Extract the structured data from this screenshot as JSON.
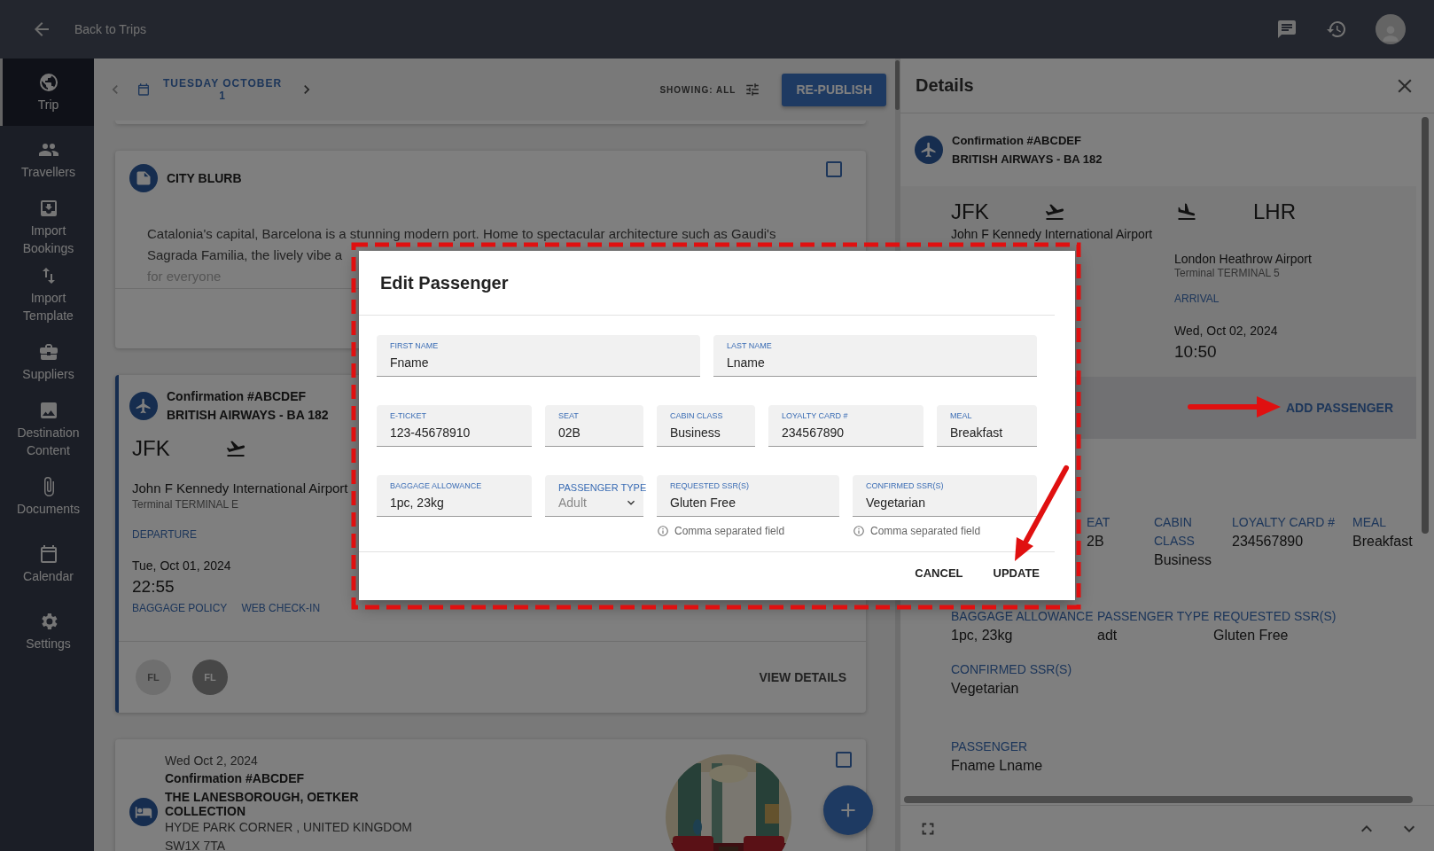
{
  "top_bar": {
    "back_label": "Back to Trips"
  },
  "sidebar": {
    "items": [
      {
        "label": "Trip",
        "selected": true
      },
      {
        "label": "Travellers",
        "selected": false
      },
      {
        "label": "Import Bookings",
        "selected": false
      },
      {
        "label": "Import Template",
        "selected": false
      },
      {
        "label": "Suppliers",
        "selected": false
      },
      {
        "label": "Destination Content",
        "selected": false
      },
      {
        "label": "Documents",
        "selected": false
      },
      {
        "label": "Calendar",
        "selected": false
      },
      {
        "label": "Settings",
        "selected": false
      }
    ]
  },
  "day_nav": {
    "date": "TUESDAY OCTOBER 1",
    "filter_label": "SHOWING: ALL",
    "publish_button": "RE-PUBLISH"
  },
  "cards": [
    {
      "kind": "stub"
    },
    {
      "kind": "blurb",
      "title": "CITY BLURB",
      "checked": false,
      "lines": [
        "Catalonia's capital, Barcelona is a stunning modern port. Home to spectacular architecture such as Gaudi's",
        "Sagrada Familia, the lively vibe a",
        "for everyone"
      ]
    },
    {
      "kind": "flight",
      "confirmation": "Confirmation #ABCDEF",
      "airline": "BRITISH AIRWAYS - BA 182",
      "code": "JFK",
      "airport": "John F Kennedy International Airport",
      "terminal": "Terminal TERMINAL E",
      "label": "DEPARTURE",
      "date": "Tue, Oct 01, 2024",
      "time": "22:55",
      "links": [
        "BAGGAGE POLICY",
        "WEB CHECK-IN"
      ],
      "avatars": [
        {
          "initials": "FL",
          "faded": true
        },
        {
          "initials": "FL",
          "faded": false
        }
      ],
      "action": "VIEW DETAILS"
    },
    {
      "kind": "hotel",
      "date": "Wed Oct 2, 2024",
      "confirmation": "Confirmation #ABCDEF",
      "name": "THE LANESBOROUGH, OETKER COLLECTION",
      "address": "HYDE PARK CORNER , UNITED KINGDOM SW1X 7TA",
      "checked": false
    }
  ],
  "details": {
    "title": "Details",
    "confirmation": "Confirmation #ABCDEF",
    "airline": "BRITISH AIRWAYS - BA 182",
    "origin": {
      "code": "JFK",
      "airport": "John F Kennedy International Airport"
    },
    "destination": {
      "code": "LHR",
      "airport": "London Heathrow Airport",
      "terminal": "Terminal TERMINAL 5",
      "label": "ARRIVAL",
      "date": "Wed, Oct 02, 2024",
      "time": "10:50"
    },
    "add_button": "ADD PASSENGER",
    "field_rows": [
      [
        {
          "label": "EAT",
          "value": "2B"
        },
        {
          "label": "CABIN CLASS",
          "value": "Business"
        },
        {
          "label": "LOYALTY CARD #",
          "value": "234567890"
        },
        {
          "label": "MEAL",
          "value": "Breakfast"
        }
      ],
      [
        {
          "label": "BAGGAGE ALLOWANCE",
          "value": "1pc, 23kg"
        },
        {
          "label": "PASSENGER TYPE",
          "value": "adt"
        },
        {
          "label": "REQUESTED SSR(S)",
          "value": "Gluten Free"
        }
      ],
      [
        {
          "label": "CONFIRMED SSR(S)",
          "value": "Vegetarian"
        }
      ],
      [
        {
          "label": "PASSENGER",
          "value": "Fname Lname"
        }
      ]
    ]
  },
  "dialog": {
    "title": "Edit Passenger",
    "rows": [
      [
        {
          "kind": "text",
          "label": "FIRST NAME",
          "value": "Fname"
        },
        {
          "kind": "text",
          "label": "LAST NAME",
          "value": "Lname"
        }
      ],
      [
        {
          "kind": "text",
          "label": "E-TICKET",
          "value": "123-45678910"
        },
        {
          "kind": "text",
          "label": "SEAT",
          "value": "02B"
        },
        {
          "kind": "text",
          "label": "CABIN CLASS",
          "value": "Business"
        },
        {
          "kind": "text",
          "label": "LOYALTY CARD #",
          "value": "234567890"
        },
        {
          "kind": "text",
          "label": "MEAL",
          "value": "Breakfast"
        }
      ],
      [
        {
          "kind": "text",
          "label": "BAGGAGE ALLOWANCE",
          "value": "1pc, 23kg"
        },
        {
          "kind": "select",
          "label": "PASSENGER TYPE",
          "value": "Adult"
        },
        {
          "kind": "text",
          "label": "REQUESTED SSR(S)",
          "value": "Gluten Free",
          "helper": "Comma separated field"
        },
        {
          "kind": "text",
          "label": "CONFIRMED SSR(S)",
          "value": "Vegetarian",
          "helper": "Comma separated field"
        }
      ]
    ],
    "buttons": [
      "CANCEL",
      "UPDATE"
    ]
  }
}
